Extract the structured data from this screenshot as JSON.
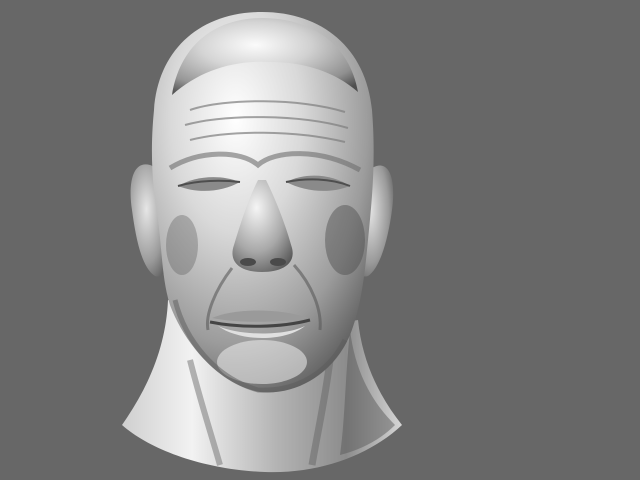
{
  "scene": {
    "background_color": "#676767",
    "subject": "sculpted-head-render",
    "material": "glossy-clay"
  }
}
